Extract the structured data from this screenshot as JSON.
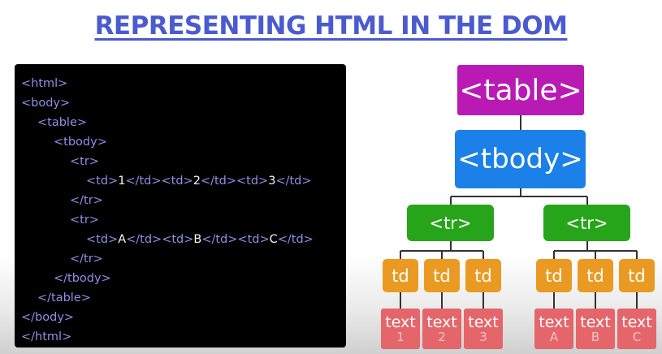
{
  "title": "REPRESENTING HTML IN THE DOM",
  "code_lines": [
    {
      "indent": 0,
      "parts": [
        {
          "t": "<html>",
          "v": false
        }
      ]
    },
    {
      "indent": 0,
      "parts": [
        {
          "t": "<body>",
          "v": false
        }
      ]
    },
    {
      "indent": 1,
      "parts": [
        {
          "t": "<table>",
          "v": false
        }
      ]
    },
    {
      "indent": 2,
      "parts": [
        {
          "t": "<tbody>",
          "v": false
        }
      ]
    },
    {
      "indent": 3,
      "parts": [
        {
          "t": "<tr>",
          "v": false
        }
      ]
    },
    {
      "indent": 4,
      "parts": [
        {
          "t": "<td>",
          "v": false
        },
        {
          "t": "1",
          "v": true
        },
        {
          "t": "</td><td>",
          "v": false
        },
        {
          "t": "2",
          "v": true
        },
        {
          "t": "</td><td>",
          "v": false
        },
        {
          "t": "3",
          "v": true
        },
        {
          "t": "</td>",
          "v": false
        }
      ]
    },
    {
      "indent": 3,
      "parts": [
        {
          "t": "</tr>",
          "v": false
        }
      ]
    },
    {
      "indent": 3,
      "parts": [
        {
          "t": "<tr>",
          "v": false
        }
      ]
    },
    {
      "indent": 4,
      "parts": [
        {
          "t": "<td>",
          "v": false
        },
        {
          "t": "A",
          "v": true
        },
        {
          "t": "</td><td>",
          "v": false
        },
        {
          "t": "B",
          "v": true
        },
        {
          "t": "</td><td>",
          "v": false
        },
        {
          "t": "C",
          "v": true
        },
        {
          "t": "</td>",
          "v": false
        }
      ]
    },
    {
      "indent": 3,
      "parts": [
        {
          "t": "</tr>",
          "v": false
        }
      ]
    },
    {
      "indent": 2,
      "parts": [
        {
          "t": "</tbody>",
          "v": false
        }
      ]
    },
    {
      "indent": 1,
      "parts": [
        {
          "t": "</table>",
          "v": false
        }
      ]
    },
    {
      "indent": 0,
      "parts": [
        {
          "t": "</body>",
          "v": false
        }
      ]
    },
    {
      "indent": 0,
      "parts": [
        {
          "t": "</html>",
          "v": false
        }
      ]
    }
  ],
  "tree": {
    "table": "<table>",
    "tbody": "<tbody>",
    "tr": [
      "<tr>",
      "<tr>"
    ],
    "td": [
      "td",
      "td",
      "td",
      "td",
      "td",
      "td"
    ],
    "text": [
      {
        "label": "text",
        "sub": "1"
      },
      {
        "label": "text",
        "sub": "2"
      },
      {
        "label": "text",
        "sub": "3"
      },
      {
        "label": "text",
        "sub": "A"
      },
      {
        "label": "text",
        "sub": "B"
      },
      {
        "label": "text",
        "sub": "C"
      }
    ]
  },
  "colors": {
    "title": "#4a5bd0",
    "table_node": "#b91ab4",
    "tbody_node": "#1b80e8",
    "tr_node": "#27a51a",
    "td_node": "#ea9a22",
    "text_node": "#e4666b",
    "code_tag": "#8f8fe8",
    "code_value": "#f4f4f4",
    "edge": "#333333"
  }
}
